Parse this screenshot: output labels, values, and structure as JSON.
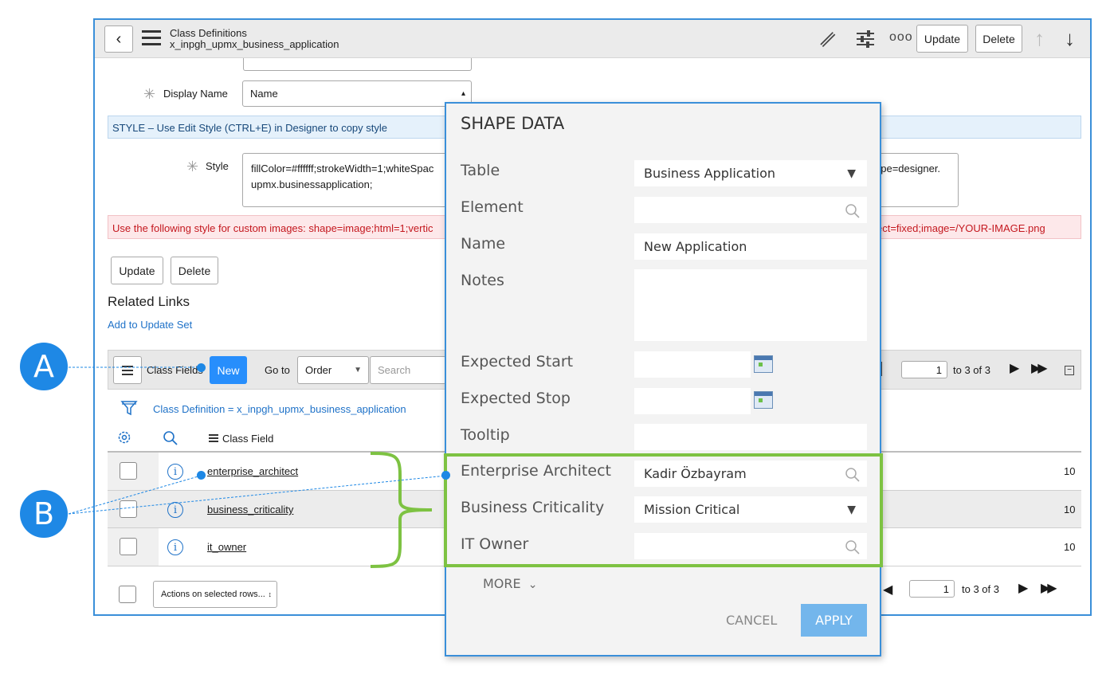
{
  "header": {
    "title": "Class Definitions",
    "subtitle": "x_inpgh_upmx_business_application",
    "update_label": "Update",
    "delete_label": "Delete"
  },
  "form": {
    "display_name_label": "Display Name",
    "display_name_value": "Name",
    "style_banner": "STYLE – Use Edit Style (CTRL+E) in Designer to copy style",
    "style_label": "Style",
    "style_value_line1_left": "fillColor=#ffffff;strokeWidth=1;whiteSpac",
    "style_value_line1_right": "ape=designer.",
    "style_value_line2": "upmx.businessapplication;",
    "custom_images_left": "Use the following style for custom images: shape=image;html=1;vertic",
    "custom_images_right": "ect=fixed;image=/YOUR-IMAGE.png",
    "update_label": "Update",
    "delete_label": "Delete",
    "related_links_title": "Related Links",
    "add_to_update_set": "Add to Update Set"
  },
  "list": {
    "title": "Class Fields",
    "new_label": "New",
    "goto_label": "Go to",
    "goto_select": "Order",
    "search_placeholder": "Search",
    "page_input": "1",
    "page_of": "to 3 of 3",
    "filter_text": "Class Definition = x_inpgh_upmx_business_application",
    "column_class_field": "Class Field",
    "rows": [
      {
        "name": "enterprise_architect",
        "order": "10"
      },
      {
        "name": "business_criticality",
        "order": "10"
      },
      {
        "name": "it_owner",
        "order": "10"
      }
    ],
    "actions_select": "Actions on selected rows...",
    "footer_page_input": "1",
    "footer_page_of": "to 3 of 3"
  },
  "dialog": {
    "title": "SHAPE DATA",
    "table_label": "Table",
    "table_value": "Business Application",
    "element_label": "Element",
    "name_label": "Name",
    "name_value": "New Application",
    "notes_label": "Notes",
    "expected_start_label": "Expected Start",
    "expected_stop_label": "Expected Stop",
    "tooltip_label": "Tooltip",
    "enterprise_architect_label": "Enterprise Architect",
    "enterprise_architect_value": "Kadir Özbayram",
    "business_criticality_label": "Business Criticality",
    "business_criticality_value": "Mission Critical",
    "it_owner_label": "IT Owner",
    "more_label": "MORE",
    "cancel_label": "CANCEL",
    "apply_label": "APPLY"
  },
  "callouts": {
    "a": "A",
    "b": "B"
  },
  "colors": {
    "accent": "#278efc",
    "callout": "#1e88e5",
    "highlight": "#7dc242",
    "error_text": "#c4181f"
  }
}
